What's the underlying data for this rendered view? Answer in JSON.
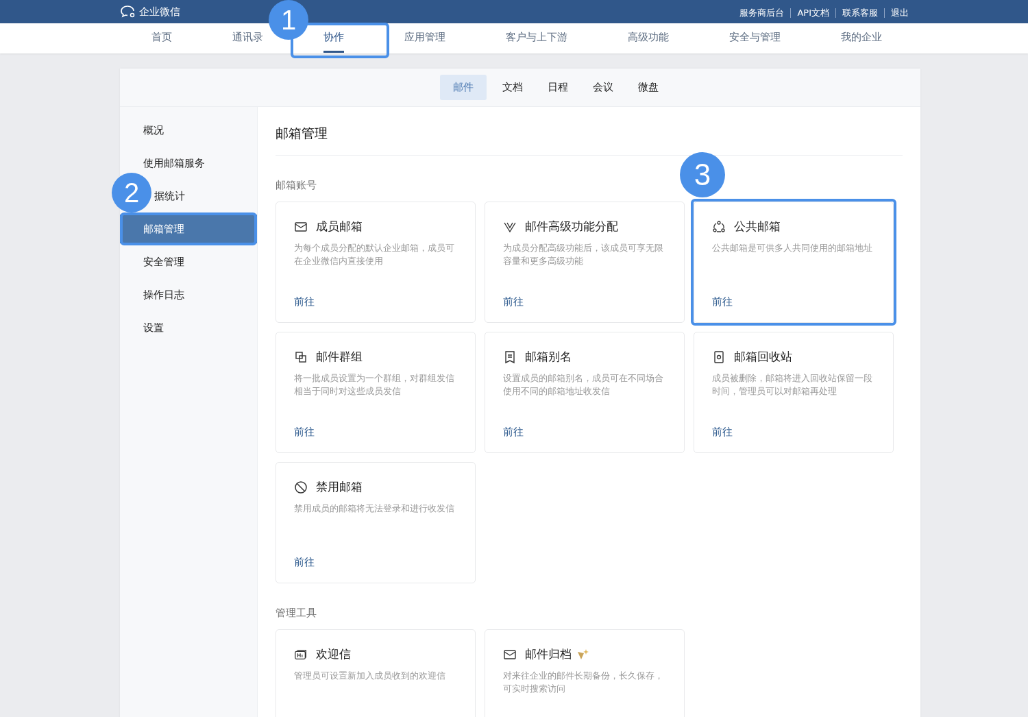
{
  "topbar": {
    "logo": "企业微信",
    "links": [
      "服务商后台",
      "API文档",
      "联系客服",
      "退出"
    ]
  },
  "nav": [
    {
      "label": "首页",
      "selected": false
    },
    {
      "label": "通讯录",
      "selected": false
    },
    {
      "label": "协作",
      "selected": true,
      "callout": "1"
    },
    {
      "label": "应用管理",
      "selected": false
    },
    {
      "label": "客户与上下游",
      "selected": false
    },
    {
      "label": "高级功能",
      "selected": false
    },
    {
      "label": "安全与管理",
      "selected": false
    },
    {
      "label": "我的企业",
      "selected": false
    }
  ],
  "subtabs": [
    {
      "label": "邮件",
      "selected": true
    },
    {
      "label": "文档",
      "selected": false
    },
    {
      "label": "日程",
      "selected": false
    },
    {
      "label": "会议",
      "selected": false
    },
    {
      "label": "微盘",
      "selected": false
    }
  ],
  "sidebar": [
    {
      "label": "概况",
      "selected": false
    },
    {
      "label": "使用邮箱服务",
      "selected": false
    },
    {
      "label": "据统计",
      "selected": false,
      "callout": "2"
    },
    {
      "label": "邮箱管理",
      "selected": true,
      "highlighted": true
    },
    {
      "label": "安全管理",
      "selected": false
    },
    {
      "label": "操作日志",
      "selected": false
    },
    {
      "label": "设置",
      "selected": false
    }
  ],
  "page_title": "邮箱管理",
  "sections": [
    {
      "label": "邮箱账号",
      "cards": [
        {
          "kind": "mail",
          "title": "成员邮箱",
          "desc": "为每个成员分配的默认企业邮箱，成员可在企业微信内直接使用",
          "link": "前往"
        },
        {
          "kind": "v",
          "title": "邮件高级功能分配",
          "desc": "为成员分配高级功能后，该成员可享无限容量和更多高级功能",
          "link": "前往"
        },
        {
          "kind": "people",
          "title": "公共邮箱",
          "desc": "公共邮箱是可供多人共同使用的邮箱地址",
          "link": "前往",
          "callout": "3"
        },
        {
          "kind": "copy",
          "title": "邮件群组",
          "desc": "将一批成员设置为一个群组，对群组发信相当于同时对这些成员发信",
          "link": "前往"
        },
        {
          "kind": "bookmark",
          "title": "邮箱别名",
          "desc": "设置成员的邮箱别名，成员可在不同场合使用不同的邮箱地址收发信",
          "link": "前往"
        },
        {
          "kind": "bin",
          "title": "邮箱回收站",
          "desc": "成员被删除，邮箱将进入回收站保留一段时间，管理员可以对邮箱再处理",
          "link": "前往"
        },
        {
          "kind": "ban",
          "title": "禁用邮箱",
          "desc": "禁用成员的邮箱将无法登录和进行收发信",
          "link": "前往"
        }
      ]
    },
    {
      "label": "管理工具",
      "cards": [
        {
          "kind": "hi",
          "title": "欢迎信",
          "desc": "管理员可设置新加入成员收到的欢迎信"
        },
        {
          "kind": "mail",
          "title": "邮件归档",
          "desc": "对来往企业的邮件长期备份，长久保存，可实时搜索访问",
          "premium": true
        }
      ]
    }
  ]
}
